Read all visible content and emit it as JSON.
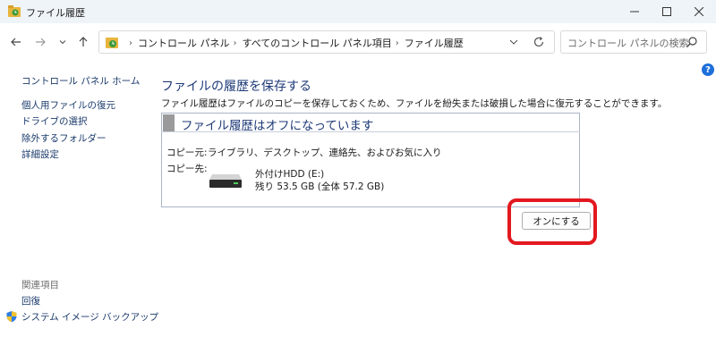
{
  "window": {
    "title": "ファイル履歴",
    "icon": "file-history-icon",
    "controls": [
      "minimize-icon",
      "maximize-icon",
      "close-icon"
    ]
  },
  "navigation": {
    "back_icon": "arrow-left-icon",
    "forward_icon": "arrow-right-icon",
    "recent_icon": "chevron-down-icon",
    "up_icon": "arrow-up-icon",
    "breadcrumb": [
      "コントロール パネル",
      "すべてのコントロール パネル項目",
      "ファイル履歴"
    ],
    "refresh_icon": "refresh-icon",
    "search_placeholder": "コントロール パネルの検索"
  },
  "help": {
    "label": "?"
  },
  "sidebar": {
    "home": "コントロール パネル ホーム",
    "links": [
      "個人用ファイルの復元",
      "ドライブの選択",
      "除外するフォルダー",
      "詳細設定"
    ],
    "related_heading": "関連項目",
    "related_links": [
      "回復",
      "システム イメージ バックアップ"
    ]
  },
  "main": {
    "title": "ファイルの履歴を保存する",
    "description": "ファイル履歴はファイルのコピーを保存しておくため、ファイルを紛失または破損した場合に復元することができます。",
    "status_title": "ファイル履歴はオフになっています",
    "copy_from_label": "コピー元:",
    "copy_from_value": "ライブラリ、デスクトップ、連絡先、およびお気に入り",
    "copy_to_label": "コピー先:",
    "drive_name": "外付けHDD (E:)",
    "drive_space": "残り 53.5 GB (全体 57.2 GB)",
    "turn_on_button": "オンにする"
  },
  "colors": {
    "accent_title": "#1e3a78",
    "link": "#1a3a6b",
    "highlight": "#e3181f",
    "titlebar": "#eff4f9"
  }
}
